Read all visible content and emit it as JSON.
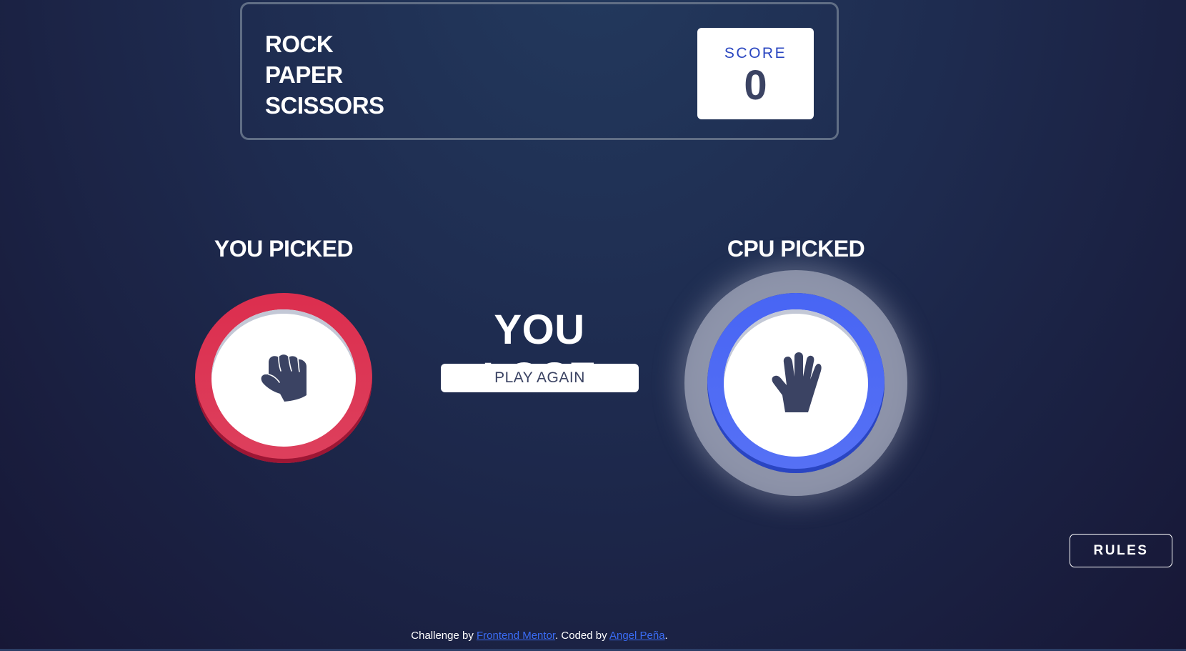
{
  "header": {
    "title_lines": [
      "ROCK",
      "PAPER",
      "SCISSORS"
    ],
    "score_label": "SCORE",
    "score_value": "0"
  },
  "game": {
    "player_label": "YOU PICKED",
    "player_choice": "rock",
    "player_icon": "fist-icon",
    "cpu_label": "CPU PICKED",
    "cpu_choice": "paper",
    "cpu_icon": "open-hand-icon",
    "result": "YOU LOSE",
    "play_again_label": "PLAY AGAIN"
  },
  "rules_button": "RULES",
  "footer": {
    "prefix": "Challenge by ",
    "link1": "Frontend Mentor",
    "middle": ". Coded by ",
    "link2": "Angel Peña",
    "suffix": "."
  },
  "colors": {
    "rock_ring": "#dc2e4e",
    "paper_ring": "#4865f4",
    "score_label": "#2a46c0",
    "dark_text": "#3b4363",
    "header_border": "#606e85"
  }
}
